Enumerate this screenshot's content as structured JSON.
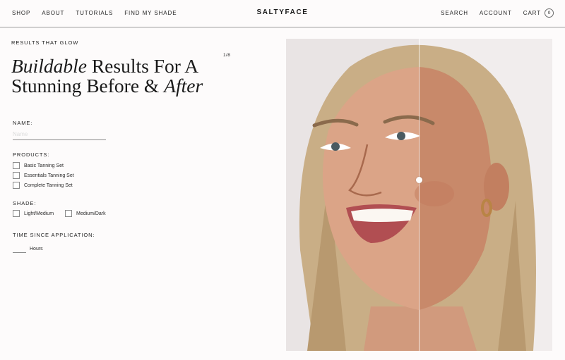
{
  "header": {
    "nav_left": [
      "SHOP",
      "ABOUT",
      "TUTORIALS",
      "FIND MY SHADE"
    ],
    "logo": "SALTYFACE",
    "search": "SEARCH",
    "account": "ACCOUNT",
    "cart_label": "CART",
    "cart_count": "0"
  },
  "hero": {
    "eyebrow": "RESULTS THAT GLOW",
    "counter": "1/8",
    "headline": {
      "part1_italic": "Buildable",
      "part2": " Results For A Stunning Before & ",
      "part3_italic": "After"
    }
  },
  "form": {
    "name_label": "NAME:",
    "name_placeholder": "Name",
    "products_label": "PRODUCTS:",
    "products": [
      "Basic Tanning Set",
      "Essentials Tanning Set",
      "Complete Tanning Set"
    ],
    "shade_label": "SHADE:",
    "shades": [
      "Light/Medium",
      "Medium/Dark"
    ],
    "time_label": "TIME SINCE APPLICATION:",
    "hours_label": "Hours"
  },
  "comparison": {
    "slider_position": 0.5,
    "colors": {
      "background_before": "#e9e4e4",
      "background_after": "#f1eded",
      "hair": "#c9ae86",
      "skin_before": "#dba487",
      "skin_after": "#c8896a"
    }
  }
}
